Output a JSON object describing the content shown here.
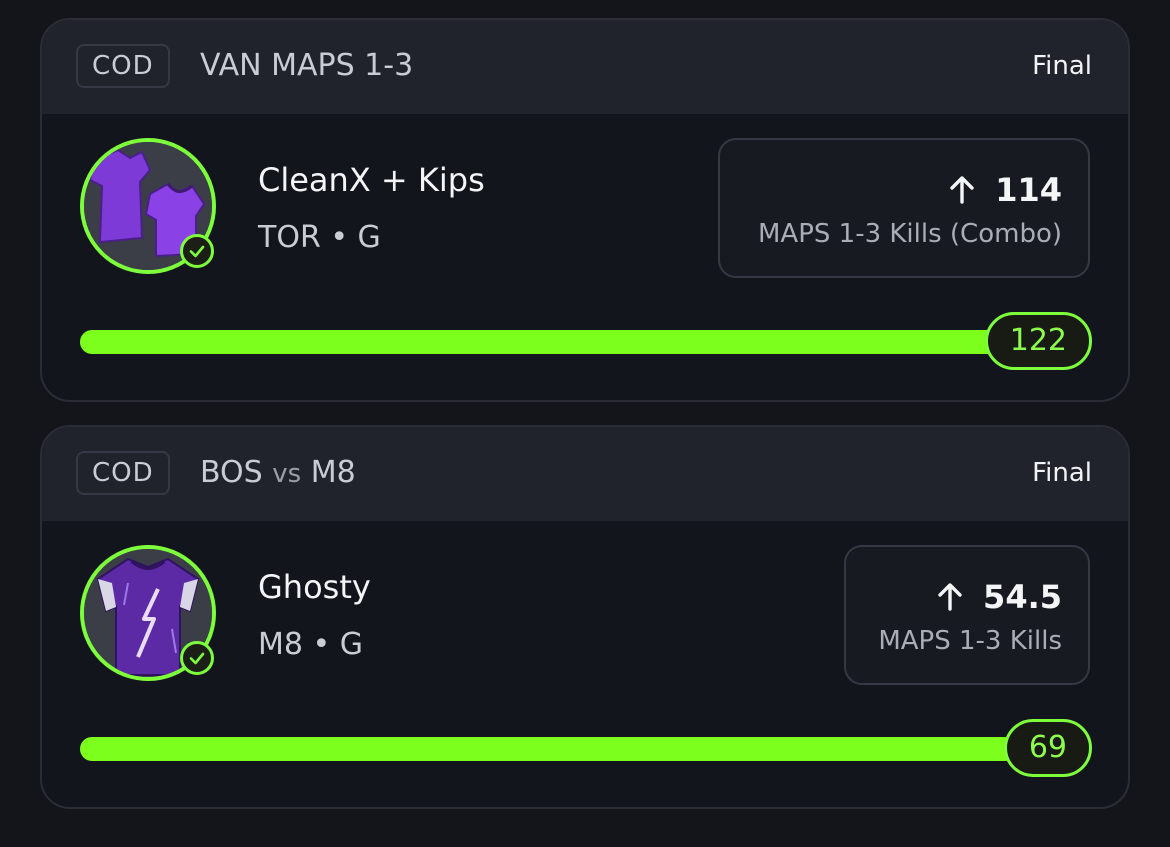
{
  "picks": [
    {
      "sport": "COD",
      "match_title": "VAN MAPS 1-3",
      "status": "Final",
      "player_name": "CleanX + Kips",
      "team": "TOR",
      "position": "G",
      "meta_text": "TOR • G",
      "direction_icon": "arrow-up-icon",
      "line": "114",
      "stat_label": "MAPS 1-3 Kills (Combo)",
      "result": "122",
      "progress_fraction": 1.0,
      "avatar": "purple-jersey-pair",
      "checked": true
    },
    {
      "sport": "COD",
      "match_home": "BOS",
      "match_vs": "vs",
      "match_away": "M8",
      "status": "Final",
      "player_name": "Ghosty",
      "team": "M8",
      "position": "G",
      "meta_text": "M8 • G",
      "direction_icon": "arrow-up-icon",
      "line": "54.5",
      "stat_label": "MAPS 1-3 Kills",
      "result": "69",
      "progress_fraction": 1.0,
      "avatar": "purple-lightning-jersey",
      "checked": true
    }
  ],
  "colors": {
    "background": "#13151b",
    "header": "#20232b",
    "accent_green": "#7dff1e",
    "text_primary": "#f4f5f7",
    "text_secondary": "#c9ccd3"
  }
}
